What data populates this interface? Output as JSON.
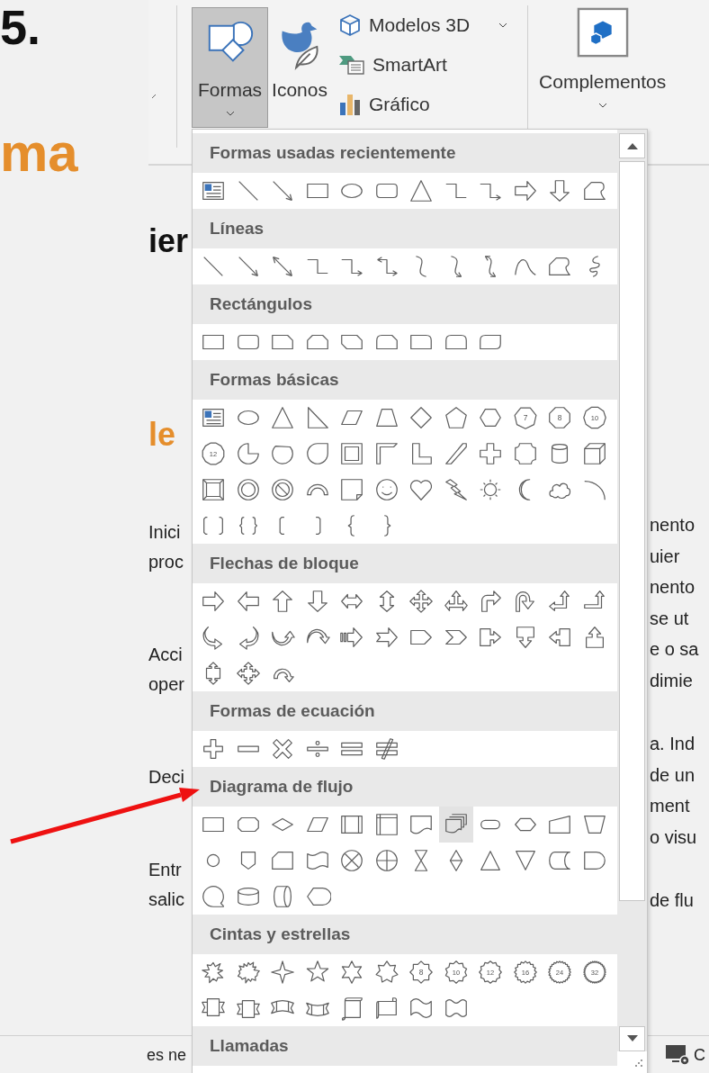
{
  "document": {
    "number": "5.",
    "title": "ma",
    "subheading": "ier",
    "section_heading": "le",
    "left_paragraphs": [
      {
        "lines": [
          "Inici",
          "proc"
        ]
      },
      {
        "lines": [
          "Acci",
          "oper"
        ]
      },
      {
        "lines": [
          "Deci"
        ]
      },
      {
        "lines": [
          "Entr",
          "salic"
        ]
      }
    ],
    "right_paragraphs": [
      {
        "lines": [
          "nento",
          "uier",
          "nento",
          "se ut",
          "e o sa",
          "dimie"
        ]
      },
      {
        "lines": [
          "a. Ind",
          "de un",
          "ment",
          "o visu"
        ]
      },
      {
        "lines": [
          "de flu"
        ]
      }
    ],
    "footer_left": "es ne",
    "footer_right": "C"
  },
  "ribbon": {
    "large_buttons": [
      {
        "label": "Formas",
        "kind": "shapes",
        "pressed": true,
        "dropdown": true
      },
      {
        "label": "Iconos",
        "kind": "icons",
        "pressed": false,
        "dropdown": false
      }
    ],
    "small_buttons": [
      {
        "label": "Modelos 3D",
        "kind": "models",
        "dropdown": true
      },
      {
        "label": "SmartArt",
        "kind": "smartart",
        "dropdown": false
      },
      {
        "label": "Gráfico",
        "kind": "chart",
        "dropdown": false
      }
    ],
    "addins": {
      "label": "Complementos",
      "dropdown": true
    }
  },
  "gallery": {
    "sections": [
      {
        "title": "Formas usadas recientemente",
        "shapes": [
          {
            "kind": "textbox",
            "selected": false
          },
          {
            "kind": "line",
            "selected": false
          },
          {
            "kind": "arrow-line",
            "selected": false
          },
          {
            "kind": "rect",
            "selected": false
          },
          {
            "kind": "oval",
            "selected": false
          },
          {
            "kind": "rounded-rect",
            "selected": false
          },
          {
            "kind": "triangle",
            "selected": false
          },
          {
            "kind": "elbow",
            "selected": false
          },
          {
            "kind": "elbow-arrow",
            "selected": false
          },
          {
            "kind": "right-arrow",
            "selected": false
          },
          {
            "kind": "down-arrow",
            "selected": false
          },
          {
            "kind": "freeform",
            "selected": false
          }
        ]
      },
      {
        "title": "Líneas",
        "shapes": [
          {
            "kind": "line",
            "selected": false
          },
          {
            "kind": "arrow-line",
            "selected": false
          },
          {
            "kind": "double-arrow-line",
            "selected": false
          },
          {
            "kind": "elbow",
            "selected": false
          },
          {
            "kind": "elbow-arrow",
            "selected": false
          },
          {
            "kind": "elbow-double-arrow",
            "selected": false
          },
          {
            "kind": "curve",
            "selected": false
          },
          {
            "kind": "curve-arrow",
            "selected": false
          },
          {
            "kind": "curve-double-arrow",
            "selected": false
          },
          {
            "kind": "freeform-curve",
            "selected": false
          },
          {
            "kind": "freeform",
            "selected": false
          },
          {
            "kind": "scribble",
            "selected": false
          }
        ]
      },
      {
        "title": "Rectángulos",
        "shapes": [
          {
            "kind": "rect",
            "selected": false
          },
          {
            "kind": "rounded-rect",
            "selected": false
          },
          {
            "kind": "snip-corner",
            "selected": false
          },
          {
            "kind": "snip-same-side",
            "selected": false
          },
          {
            "kind": "snip-diagonal",
            "selected": false
          },
          {
            "kind": "snip-round",
            "selected": false
          },
          {
            "kind": "round-corner",
            "selected": false
          },
          {
            "kind": "round-same-side",
            "selected": false
          },
          {
            "kind": "round-diagonal",
            "selected": false
          }
        ]
      },
      {
        "title": "Formas básicas",
        "shapes": [
          {
            "kind": "textbox",
            "selected": false
          },
          {
            "kind": "oval",
            "selected": false
          },
          {
            "kind": "triangle",
            "selected": false
          },
          {
            "kind": "right-triangle",
            "selected": false
          },
          {
            "kind": "parallelogram",
            "selected": false
          },
          {
            "kind": "trapezoid",
            "selected": false
          },
          {
            "kind": "diamond",
            "selected": false
          },
          {
            "kind": "pentagon",
            "selected": false
          },
          {
            "kind": "hexagon",
            "selected": false
          },
          {
            "kind": "heptagon",
            "label": "7",
            "selected": false
          },
          {
            "kind": "octagon",
            "label": "8",
            "selected": false
          },
          {
            "kind": "decagon",
            "label": "10",
            "selected": false
          },
          {
            "kind": "dodecagon",
            "label": "12",
            "selected": false
          },
          {
            "kind": "pie",
            "selected": false
          },
          {
            "kind": "chord",
            "selected": false
          },
          {
            "kind": "teardrop",
            "selected": false
          },
          {
            "kind": "frame",
            "selected": false
          },
          {
            "kind": "half-frame",
            "selected": false
          },
          {
            "kind": "l-shape",
            "selected": false
          },
          {
            "kind": "diagonal-stripe",
            "selected": false
          },
          {
            "kind": "cross",
            "selected": false
          },
          {
            "kind": "plaque",
            "selected": false
          },
          {
            "kind": "can",
            "selected": false
          },
          {
            "kind": "cube",
            "selected": false
          },
          {
            "kind": "bevel",
            "selected": false
          },
          {
            "kind": "donut",
            "selected": false
          },
          {
            "kind": "no-symbol",
            "selected": false
          },
          {
            "kind": "block-arc",
            "selected": false
          },
          {
            "kind": "folded-corner",
            "selected": false
          },
          {
            "kind": "smiley",
            "selected": false
          },
          {
            "kind": "heart",
            "selected": false
          },
          {
            "kind": "lightning",
            "selected": false
          },
          {
            "kind": "sun",
            "selected": false
          },
          {
            "kind": "moon",
            "selected": false
          },
          {
            "kind": "cloud",
            "selected": false
          },
          {
            "kind": "arc",
            "selected": false
          },
          {
            "kind": "double-bracket",
            "selected": false
          },
          {
            "kind": "double-brace",
            "selected": false
          },
          {
            "kind": "left-bracket",
            "selected": false
          },
          {
            "kind": "right-bracket",
            "selected": false
          },
          {
            "kind": "left-brace",
            "selected": false
          },
          {
            "kind": "right-brace",
            "selected": false
          }
        ]
      },
      {
        "title": "Flechas de bloque",
        "shapes": [
          {
            "kind": "right-arrow",
            "selected": false
          },
          {
            "kind": "left-arrow",
            "selected": false
          },
          {
            "kind": "up-arrow",
            "selected": false
          },
          {
            "kind": "down-arrow",
            "selected": false
          },
          {
            "kind": "left-right-arrow",
            "selected": false
          },
          {
            "kind": "up-down-arrow",
            "selected": false
          },
          {
            "kind": "quad-arrow",
            "selected": false
          },
          {
            "kind": "left-right-up-arrow",
            "selected": false
          },
          {
            "kind": "bent-arrow",
            "selected": false
          },
          {
            "kind": "u-turn-arrow",
            "selected": false
          },
          {
            "kind": "left-up-arrow",
            "selected": false
          },
          {
            "kind": "bent-up-arrow",
            "selected": false
          },
          {
            "kind": "curved-right-arrow",
            "selected": false
          },
          {
            "kind": "curved-left-arrow",
            "selected": false
          },
          {
            "kind": "curved-up-arrow",
            "selected": false
          },
          {
            "kind": "curved-down-arrow",
            "selected": false
          },
          {
            "kind": "striped-right-arrow",
            "selected": false
          },
          {
            "kind": "notched-right-arrow",
            "selected": false
          },
          {
            "kind": "pentagon-arrow",
            "selected": false
          },
          {
            "kind": "chevron",
            "selected": false
          },
          {
            "kind": "right-arrow-callout",
            "selected": false
          },
          {
            "kind": "down-arrow-callout",
            "selected": false
          },
          {
            "kind": "left-arrow-callout",
            "selected": false
          },
          {
            "kind": "up-arrow-callout",
            "selected": false
          },
          {
            "kind": "up-down-arrow-callout",
            "selected": false
          },
          {
            "kind": "quad-arrow-callout",
            "selected": false
          },
          {
            "kind": "circular-arrow",
            "selected": false
          }
        ]
      },
      {
        "title": "Formas de ecuación",
        "shapes": [
          {
            "kind": "math-plus",
            "selected": false
          },
          {
            "kind": "math-minus",
            "selected": false
          },
          {
            "kind": "math-multiply",
            "selected": false
          },
          {
            "kind": "math-divide",
            "selected": false
          },
          {
            "kind": "math-equal",
            "selected": false
          },
          {
            "kind": "math-not-equal",
            "selected": false
          }
        ]
      },
      {
        "title": "Diagrama de flujo",
        "shapes": [
          {
            "kind": "flow-process",
            "selected": false
          },
          {
            "kind": "flow-alternate-process",
            "selected": false
          },
          {
            "kind": "flow-decision",
            "selected": false
          },
          {
            "kind": "flow-data",
            "selected": false
          },
          {
            "kind": "flow-predefined",
            "selected": false
          },
          {
            "kind": "flow-internal-storage",
            "selected": false
          },
          {
            "kind": "flow-document",
            "selected": false
          },
          {
            "kind": "flow-multidocument",
            "selected": true
          },
          {
            "kind": "flow-terminator",
            "selected": false
          },
          {
            "kind": "flow-preparation",
            "selected": false
          },
          {
            "kind": "flow-manual-input",
            "selected": false
          },
          {
            "kind": "flow-manual-operation",
            "selected": false
          },
          {
            "kind": "flow-connector",
            "selected": false
          },
          {
            "kind": "flow-off-page",
            "selected": false
          },
          {
            "kind": "flow-card",
            "selected": false
          },
          {
            "kind": "flow-punched-tape",
            "selected": false
          },
          {
            "kind": "flow-summing-junction",
            "selected": false
          },
          {
            "kind": "flow-or",
            "selected": false
          },
          {
            "kind": "flow-collate",
            "selected": false
          },
          {
            "kind": "flow-sort",
            "selected": false
          },
          {
            "kind": "flow-extract",
            "selected": false
          },
          {
            "kind": "flow-merge",
            "selected": false
          },
          {
            "kind": "flow-stored-data",
            "selected": false
          },
          {
            "kind": "flow-delay",
            "selected": false
          },
          {
            "kind": "flow-sequential-access",
            "selected": false
          },
          {
            "kind": "flow-magnetic-disk",
            "selected": false
          },
          {
            "kind": "flow-direct-access",
            "selected": false
          },
          {
            "kind": "flow-display",
            "selected": false
          }
        ]
      },
      {
        "title": "Cintas y estrellas",
        "shapes": [
          {
            "kind": "explosion",
            "selected": false
          },
          {
            "kind": "explosion-large",
            "selected": false
          },
          {
            "kind": "star-4",
            "selected": false
          },
          {
            "kind": "star-5",
            "selected": false
          },
          {
            "kind": "star-6",
            "selected": false
          },
          {
            "kind": "star-7",
            "selected": false
          },
          {
            "kind": "star-8",
            "label": "8",
            "selected": false
          },
          {
            "kind": "star-10",
            "label": "10",
            "selected": false
          },
          {
            "kind": "star-12",
            "label": "12",
            "selected": false
          },
          {
            "kind": "star-16",
            "label": "16",
            "selected": false
          },
          {
            "kind": "star-24",
            "label": "24",
            "selected": false
          },
          {
            "kind": "star-32",
            "label": "32",
            "selected": false
          },
          {
            "kind": "ribbon-down",
            "selected": false
          },
          {
            "kind": "ribbon-up",
            "selected": false
          },
          {
            "kind": "curved-ribbon-down",
            "selected": false
          },
          {
            "kind": "curved-ribbon-up",
            "selected": false
          },
          {
            "kind": "vertical-scroll",
            "selected": false
          },
          {
            "kind": "horizontal-scroll",
            "selected": false
          },
          {
            "kind": "wave",
            "selected": false
          },
          {
            "kind": "double-wave",
            "selected": false
          }
        ]
      },
      {
        "title": "Llamadas"
      }
    ]
  }
}
